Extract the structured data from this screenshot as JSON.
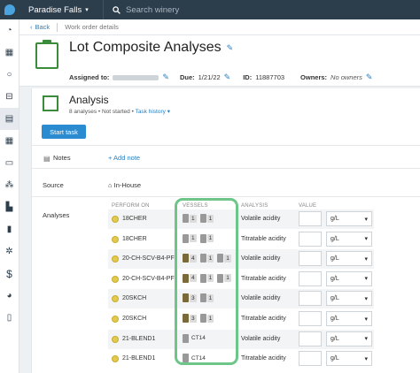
{
  "app": {
    "winery": "Paradise Falls",
    "search_placeholder": "Search winery"
  },
  "sidebar": {
    "icons": [
      "dashboard-icon",
      "calendar-icon",
      "circle-icon",
      "barrel-icon",
      "clipboard-icon",
      "grid-icon",
      "box-icon",
      "network-icon",
      "truck-icon",
      "bar-chart-icon",
      "gears-icon",
      "dollar-icon",
      "pie-chart-icon",
      "phone-icon"
    ]
  },
  "breadcrumb": {
    "back": "Back",
    "current": "Work order details"
  },
  "header": {
    "title": "Lot Composite Analyses",
    "assigned_label": "Assigned to:",
    "due_label": "Due:",
    "due_value": "1/21/22",
    "id_label": "ID:",
    "id_value": "11887703",
    "owners_label": "Owners:",
    "owners_value": "No owners"
  },
  "analysis": {
    "title": "Analysis",
    "subtitle_count": "8 analyses",
    "subtitle_status": "Not started",
    "subtitle_link": "Task history",
    "start_button": "Start task",
    "notes_label": "Notes",
    "add_note": "+ Add note",
    "source_label": "Source",
    "source_value": "In-House",
    "analyses_label": "Analyses",
    "columns": {
      "perform_on": "PERFORM ON",
      "vessels": "VESSELS",
      "analysis": "ANALYSIS",
      "value": "VALUE"
    },
    "rows": [
      {
        "lot": "18CHER",
        "vessels": [
          {
            "n": "1",
            "dark": false
          },
          {
            "n": "1",
            "dark": false
          }
        ],
        "analysis": "Volatile acidity",
        "unit": "g/L"
      },
      {
        "lot": "18CHER",
        "vessels": [
          {
            "n": "1",
            "dark": false
          },
          {
            "n": "1",
            "dark": false
          }
        ],
        "analysis": "Titratable acidity",
        "unit": "g/L"
      },
      {
        "lot": "20-CH-SCV-B4-PF",
        "vessels": [
          {
            "n": "4",
            "dark": true
          },
          {
            "n": "1",
            "dark": false
          },
          {
            "n": "1",
            "dark": false
          }
        ],
        "analysis": "Volatile acidity",
        "unit": "g/L"
      },
      {
        "lot": "20-CH-SCV-B4-PF",
        "vessels": [
          {
            "n": "4",
            "dark": true
          },
          {
            "n": "1",
            "dark": false
          },
          {
            "n": "1",
            "dark": false
          }
        ],
        "analysis": "Titratable acidity",
        "unit": "g/L"
      },
      {
        "lot": "20SKCH",
        "vessels": [
          {
            "n": "3",
            "dark": true
          },
          {
            "n": "1",
            "dark": false
          }
        ],
        "analysis": "Volatile acidity",
        "unit": "g/L"
      },
      {
        "lot": "20SKCH",
        "vessels": [
          {
            "n": "3",
            "dark": true
          },
          {
            "n": "1",
            "dark": false
          }
        ],
        "analysis": "Titratable acidity",
        "unit": "g/L"
      },
      {
        "lot": "21-BLEND1",
        "vessels": [
          {
            "name": "CT14"
          }
        ],
        "analysis": "Volatile acidity",
        "unit": "g/L"
      },
      {
        "lot": "21-BLEND1",
        "vessels": [
          {
            "name": "CT14"
          }
        ],
        "analysis": "Titratable acidity",
        "unit": "g/L"
      }
    ]
  },
  "colors": {
    "topbar": "#2c3d4c",
    "accent": "#2a8bd0",
    "green": "#3a8b3a",
    "highlight": "#6dc58a",
    "dot": "#e3c94d"
  }
}
